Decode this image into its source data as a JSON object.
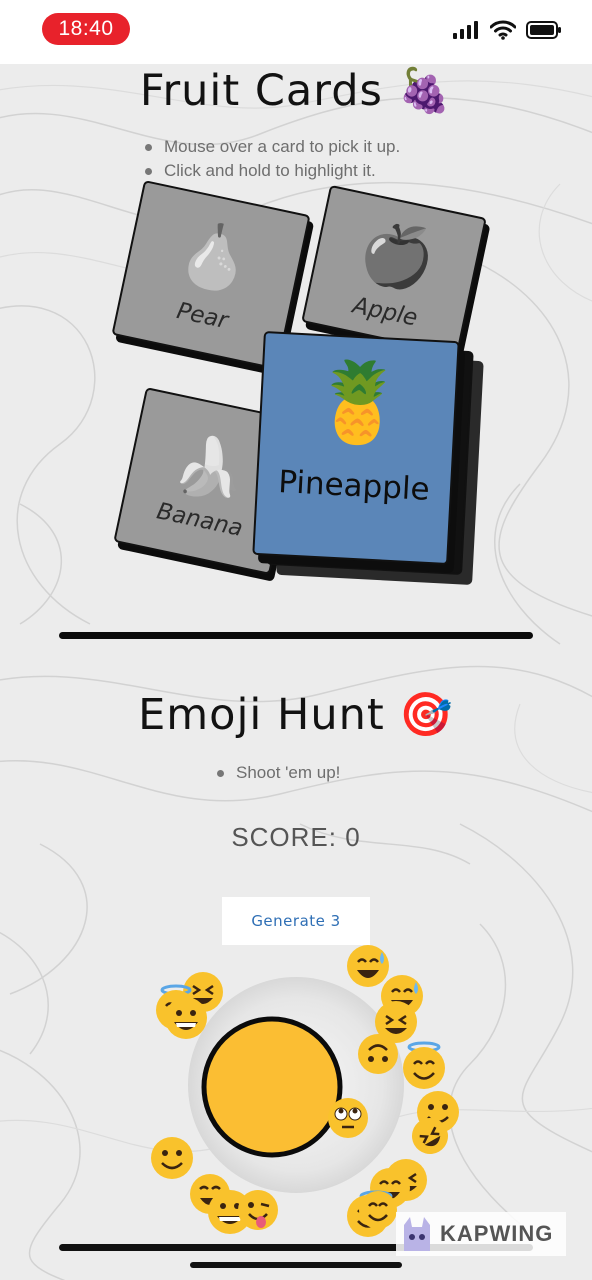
{
  "status_bar": {
    "time": "18:40"
  },
  "fruit_cards": {
    "title": "Fruit Cards 🍇",
    "instructions": [
      "Mouse over a card to pick it up.",
      "Click and hold to highlight it."
    ],
    "cards": [
      {
        "label": "Pear",
        "emoji": "🍐"
      },
      {
        "label": "Apple",
        "emoji": "🍎"
      },
      {
        "label": "Banana",
        "emoji": "🍌"
      },
      {
        "label": "Pineapple",
        "emoji": "🍍"
      }
    ],
    "highlight_color": "#5b86b8"
  },
  "emoji_hunt": {
    "title": "Emoji Hunt 🎯",
    "instructions": [
      "Shoot 'em up!"
    ],
    "score_label": "SCORE: 0",
    "generate_button": "Generate 3",
    "target_color": "#fbbe33"
  },
  "watermark": {
    "text": "KAPWING"
  }
}
